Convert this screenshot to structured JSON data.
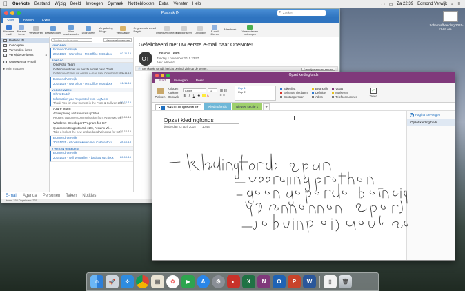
{
  "menubar": {
    "apple": "",
    "app": "OneNote",
    "items": [
      "Bestand",
      "Wijzig",
      "Beeld",
      "Invoegen",
      "Opmaak",
      "Notitieblokken",
      "Extra",
      "Venster",
      "Help"
    ],
    "status": {
      "battery": "≈",
      "clock": "Za 22:39",
      "user": "Edmond Verwijk"
    }
  },
  "desktop": {
    "icon_label": "Schermafbeelding 2015-11-07 om..."
  },
  "outlook": {
    "window_title": "Postvak IN",
    "search_placeholder": "Zoeken",
    "tabs": [
      "Start",
      "Indelen",
      "Extra"
    ],
    "ribbon": {
      "new_email": "Nieuwe e-mail",
      "new_items": "Nieuwe items",
      "delete": "Verwijderen",
      "archive": "Beantwoorden",
      "reply_all": "Allen beantwoorden",
      "forward": "Doorsturen",
      "meeting": "Vergadering",
      "attachment": "Bijlage",
      "move": "Verplaatsen",
      "junk": "Ongewenste e-mail",
      "rules": "Regels",
      "unread": "Ongelezen/gelezen",
      "categorize": "Categoriseren",
      "followup": "Opvolgen",
      "filter": "E-mail filteren",
      "addressbook": "Adresboek",
      "send_receive": "Verzenden en ontvangen"
    },
    "folders": [
      {
        "label": "Postvak IN",
        "count": ""
      },
      {
        "label": "Concepten",
        "count": ""
      },
      {
        "label": "Verzonden items",
        "count": ""
      },
      {
        "label": "Verwijderde items",
        "count": "4"
      },
      {
        "label": "Ongewenste e-mail",
        "count": ""
      },
      {
        "label": "Mijn mappen",
        "count": ""
      }
    ],
    "list": {
      "search_placeholder": "Zoeken in deze map",
      "sort": "Nieuwste bovenaan",
      "groups": {
        "today": "VANDAAG",
        "sunday": "ZONDAG",
        "last_week": "VORIGE WEEK",
        "two_weeks": "2 WEKEN GELEDEN"
      },
      "messages": [
        {
          "from": "Edmond Verwijk",
          "subject": "20151026 - Workshop - MS Office 2016.docx",
          "preview": "",
          "date": "02-11-15"
        },
        {
          "from": "OneNote Team",
          "subject": "Gefeliciteerd met uw eerste e-mail naar OneN...",
          "preview": "Gefeliciteerd met uw eerste e-mail naar OneNote! Uw e...",
          "date": "01-11-15"
        },
        {
          "from": "Edmond Verwijk",
          "subject": "20151026 - Workshop - MS Office 2016.docx",
          "preview": "",
          "date": "01-11-15"
        },
        {
          "from": "Chris Dutch",
          "subject": "Information you Requested from LogMeIn",
          "preview": "Thank You for Your Interest in the Frost & Sullivan 2015...",
          "date": "29-10-15"
        },
        {
          "from": "Azure Team",
          "subject": "Azure pricing and services updates",
          "preview": "Request customer communication from Azure Micros...",
          "date": "29-10-15"
        },
        {
          "from": "Windows Developer Program for IoT",
          "subject": "Qualcomm DragonBoard 410c, Arduino Wi...",
          "preview": "Take a look at the new and updated Windows for IoT...",
          "date": "29-10-15"
        },
        {
          "from": "Edmond Verwijk",
          "subject": "20151025 - eBooks lekeren met Calibre.docx",
          "preview": "",
          "date": "28-10-15"
        },
        {
          "from": "Edmond Verwijk",
          "subject": "20151026 - Wifi versnellen - basiscursus.docx",
          "preview": "",
          "date": "26-10-15"
        }
      ]
    },
    "reading": {
      "subject": "Gefeliciteerd met uw eerste e-mail naar OneNote!",
      "avatar": "OT",
      "from": "OneNote Team",
      "date": "Zondag 1 november 2015 23:57",
      "to_label": "Aan:",
      "to": "edmond",
      "info": "Een kopie van dit bericht bevindt zich op de server.",
      "info_button": "Verwijderen van server"
    },
    "nav": [
      "E-mail",
      "Agenda",
      "Personen",
      "Taken",
      "Notities"
    ],
    "status": "Items: 338     Ongelezen: 225"
  },
  "onenote": {
    "window_title": "Opzet kledingfonds",
    "tabs": [
      "Start",
      "Invoegen",
      "Beeld"
    ],
    "ribbon": {
      "paste": "Plakken",
      "cut": "Knippen",
      "copy": "Kopiëren",
      "format": "Opmaak",
      "font": "Calibri",
      "size": "11",
      "styles": [
        "Kop 1",
        "Kop 2"
      ],
      "tags": [
        "Takenlijst",
        "Belangrijk",
        "Vraag",
        "Bekende niet laten",
        "Definitie",
        "Markeren",
        "Contactpersoon",
        "Adres",
        "Telefoonnummer"
      ],
      "task": "Taken"
    },
    "notebook": "VAKO Jeugdbestuur",
    "sections": [
      "Kledingfonds",
      "Nieuwe sectie 1"
    ],
    "add_section": "+",
    "page": {
      "title": "Opzet kledingfonds",
      "date": "donderdag 23 april 2015",
      "time": "10:44"
    },
    "handwriting": [
      "- Kledingfonds : Opzen",
      "- voorfinanciering problemen",
      "- geen gepaste betaling mogelijk",
      "by Vanhemmen Sport",
      "- je kunt nog gepaard invoeren",
      "- je kunt beginnen wel oud sokken"
    ],
    "pages_panel": {
      "add": "Pagina toevoegen",
      "items": [
        "Opzet kledingfonds"
      ]
    }
  },
  "dock": [
    "Finder",
    "Launchpad",
    "Safari",
    "Chrome",
    "Preview",
    "Photos",
    "FaceTime",
    "App Store",
    "Systeemvoorkeuren",
    "Excel",
    "OneNote",
    "Outlook",
    "PowerPoint",
    "Word",
    "Documenten",
    "Prullenmand"
  ]
}
